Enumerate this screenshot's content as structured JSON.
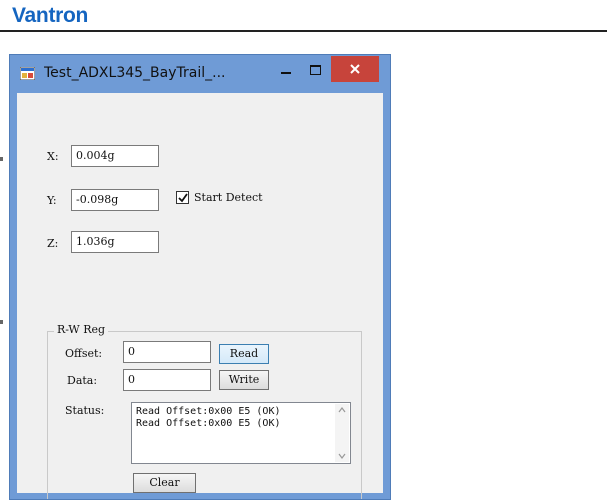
{
  "document": {
    "brand": "Vantron"
  },
  "window": {
    "title": "Test_ADXL345_BayTrail_...",
    "colors": {
      "frame": "#6f9bd6",
      "close": "#c7443b",
      "client": "#f0f0f0"
    },
    "icons": [
      "app-icon",
      "minimize-icon",
      "maximize-icon",
      "close-icon"
    ]
  },
  "accel": {
    "x_label": "X:",
    "x_value": "0.004g",
    "y_label": "Y:",
    "y_value": "-0.098g",
    "z_label": "Z:",
    "z_value": "1.036g",
    "start_detect_label": "Start Detect",
    "start_detect_checked": true
  },
  "rw_reg": {
    "group_title": "R-W Reg",
    "offset_label": "Offset:",
    "offset_value": "0",
    "read_button": "Read",
    "data_label": "Data:",
    "data_value": "0",
    "write_button": "Write",
    "status_label": "Status:",
    "status_lines": [
      "Read Offset:0x00 E5 (OK)",
      "Read Offset:0x00 E5 (OK)"
    ],
    "clear_button": "Clear"
  }
}
